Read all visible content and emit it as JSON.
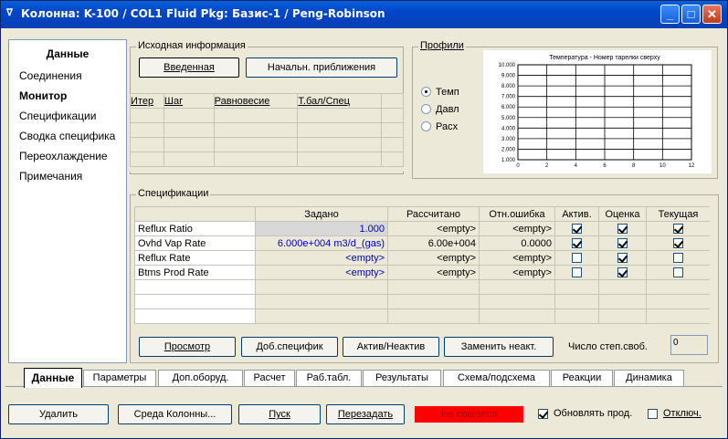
{
  "window": {
    "title": "Колонна: K-100 / COL1   Fluid Pkg: Базис-1 / Peng-Robinson",
    "min_label": "_",
    "max_label": "□",
    "close_label": "✕"
  },
  "sidebar": {
    "title": "Данные",
    "items": [
      "Соединения",
      "Монитор",
      "Спецификации",
      "Сводка специфика",
      "Переохлаждение",
      "Примечания"
    ]
  },
  "source": {
    "label": "Исходная информация",
    "entered_btn": "Введенная",
    "initial_btn": "Начальн. приближения",
    "table_headers": [
      "Итер",
      "Шаг",
      "Равновесие",
      "Т.бал/Спец"
    ]
  },
  "profiles": {
    "label": "Профили",
    "options": [
      "Темп",
      "Давл",
      "Расх"
    ],
    "selected": 0
  },
  "chart_data": {
    "type": "line",
    "title": "Температура - Номер тарелки сверху",
    "xlim": [
      0,
      12
    ],
    "ylim": [
      1000,
      10000
    ],
    "x_ticks": [
      "0",
      "2",
      "4",
      "6",
      "8",
      "10",
      "12"
    ],
    "y_ticks": [
      "1.000",
      "2.000",
      "3.000",
      "4.000",
      "5.000",
      "6.000",
      "7.000",
      "8.000",
      "9.000",
      "10.000"
    ],
    "series": []
  },
  "specs": {
    "label": "Спецификации",
    "headers": [
      "",
      "Задано",
      "Рассчитано",
      "Отн.ошибка",
      "Актив.",
      "Оценка",
      "Текущая"
    ],
    "rows": [
      {
        "name": "Reflux Ratio",
        "spec": "1.000",
        "calc": "<empty>",
        "err": "<empty>",
        "active": true,
        "estimate": true,
        "current": true
      },
      {
        "name": "Ovhd Vap Rate",
        "spec": "6.000e+004 m3/d_(gas)",
        "calc": "6.00e+004",
        "err": "0.0000",
        "active": true,
        "estimate": true,
        "current": true
      },
      {
        "name": "Reflux Rate",
        "spec": "<empty>",
        "calc": "<empty>",
        "err": "<empty>",
        "active": false,
        "estimate": true,
        "current": false
      },
      {
        "name": "Btms Prod Rate",
        "spec": "<empty>",
        "calc": "<empty>",
        "err": "<empty>",
        "active": false,
        "estimate": true,
        "current": false
      }
    ],
    "view_btn": "Просмотр",
    "add_btn": "Доб.специфик",
    "toggle_btn": "Актив/Неактив",
    "replace_btn": "Заменить неакт.",
    "dof_label": "Число степ.своб.",
    "dof_value": "0"
  },
  "tabs": [
    "Данные",
    "Параметры",
    "Доп.оборуд.",
    "Расчет",
    "Раб.табл.",
    "Результаты",
    "Схема/подсхема",
    "Реакции",
    "Динамика"
  ],
  "bottom": {
    "delete_btn": "Удалить",
    "env_btn": "Среда Колонны...",
    "run_btn": "Пуск",
    "reset_btn": "Перезадать",
    "status": "Не сошелся",
    "status_color": "#ff0000",
    "update_label": "Обновлять прод.",
    "disable_label": "Отключ."
  }
}
